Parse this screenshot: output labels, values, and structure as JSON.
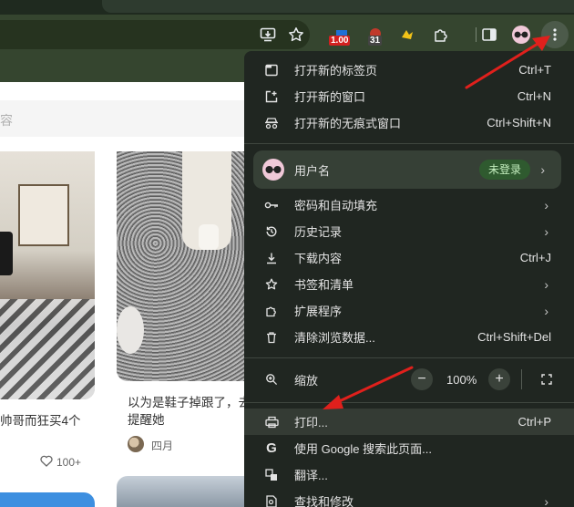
{
  "toolbar": {
    "ext_badge_1": "1.00",
    "ext_badge_2": "31"
  },
  "page": {
    "search_placeholder": "容",
    "card_left_title": "帅哥而狂买4个",
    "card_right_title": "以为是鞋子掉跟了，去提醒她",
    "author": "四月",
    "likes": "100+"
  },
  "menu": {
    "new_tab": {
      "label": "打开新的标签页",
      "shortcut": "Ctrl+T"
    },
    "new_window": {
      "label": "打开新的窗口",
      "shortcut": "Ctrl+N"
    },
    "incognito": {
      "label": "打开新的无痕式窗口",
      "shortcut": "Ctrl+Shift+N"
    },
    "profile": {
      "name": "用户名",
      "status": "未登录"
    },
    "passwords": {
      "label": "密码和自动填充"
    },
    "history": {
      "label": "历史记录"
    },
    "downloads": {
      "label": "下载内容",
      "shortcut": "Ctrl+J"
    },
    "bookmarks": {
      "label": "书签和清单"
    },
    "extensions": {
      "label": "扩展程序"
    },
    "clear_data": {
      "label": "清除浏览数据...",
      "shortcut": "Ctrl+Shift+Del"
    },
    "zoom": {
      "label": "缩放",
      "value": "100%",
      "minus": "−",
      "plus": "+"
    },
    "print": {
      "label": "打印...",
      "shortcut": "Ctrl+P"
    },
    "google_search": {
      "label": "使用 Google 搜索此页面..."
    },
    "translate": {
      "label": "翻译..."
    },
    "find": {
      "label": "查找和修改"
    }
  },
  "colors": {
    "menu_bg": "#202621",
    "toolbar_bg": "#35452f",
    "annotation_red": "#e0201c",
    "status_badge_bg": "#2f5a2f"
  }
}
